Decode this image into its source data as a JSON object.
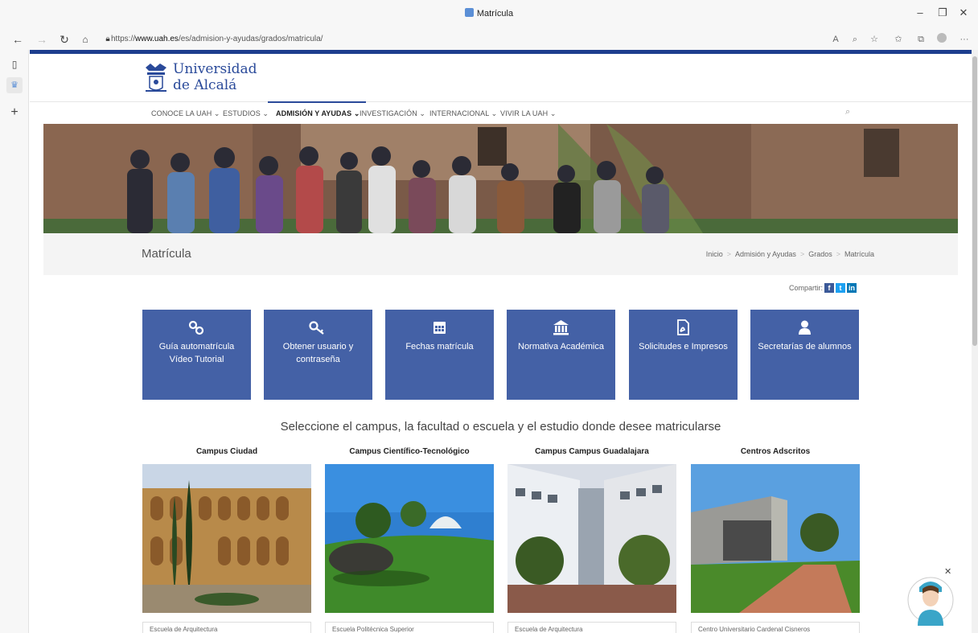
{
  "browser": {
    "tab_title": "Matrícula",
    "url_prefix": "https://",
    "url_host": "www.uah.es",
    "url_path": "/es/admision-y-ayudas/grados/matricula/",
    "minimize": "–",
    "restore": "❐",
    "close": "✕"
  },
  "site": {
    "logo_line1": "Universidad",
    "logo_line2": "de Alcalá",
    "nav": [
      {
        "label": "CONOCE LA UAH ⌄"
      },
      {
        "label": "ESTUDIOS ⌄"
      },
      {
        "label": "ADMISIÓN Y AYUDAS ⌄"
      },
      {
        "label": "INVESTIGACIÓN ⌄"
      },
      {
        "label": "INTERNACIONAL ⌄"
      },
      {
        "label": "VIVIR LA UAH ⌄"
      }
    ]
  },
  "page": {
    "title": "Matrícula",
    "breadcrumb": [
      "Inicio",
      "Admisión y Ayudas",
      "Grados",
      "Matrícula"
    ],
    "share_label": "Compartir:",
    "tiles": [
      {
        "label": "Guía automatrícula Vídeo Tutorial",
        "icon": "link-icon"
      },
      {
        "label": "Obtener usuario y contraseña",
        "icon": "key-icon"
      },
      {
        "label": "Fechas matrícula",
        "icon": "calendar-icon"
      },
      {
        "label": "Normativa Académica",
        "icon": "bank-icon"
      },
      {
        "label": "Solicitudes e Impresos",
        "icon": "pdf-icon"
      },
      {
        "label": "Secretarías de alumnos",
        "icon": "user-icon"
      }
    ],
    "headline": "Seleccione el campus, la facultad o escuela y el estudio donde desee matricularse",
    "campuses": [
      {
        "name": "Campus Ciudad",
        "select": "Escuela de Arquitectura"
      },
      {
        "name": "Campus Científico-Tecnológico",
        "select": "Escuela Politécnica Superior"
      },
      {
        "name": "Campus Campus Guadalajara",
        "select": "Escuela de Arquitectura"
      },
      {
        "name": "Centros Adscritos",
        "select": "Centro Universitario Cardenal Cisneros"
      }
    ]
  }
}
